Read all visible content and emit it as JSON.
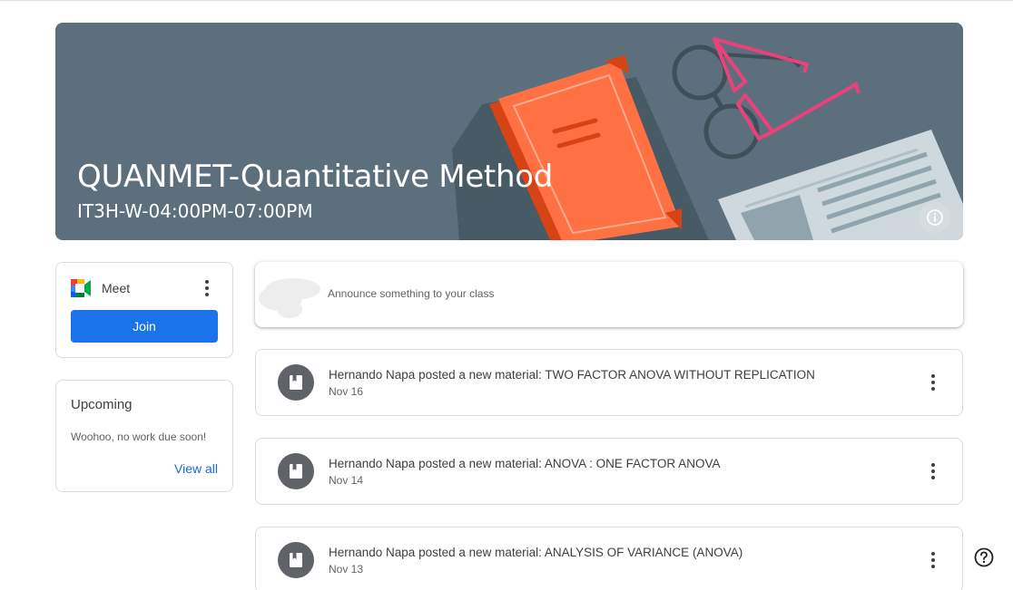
{
  "banner": {
    "title": "QUANMET-Quantitative Method",
    "subtitle": "IT3H-W-04:00PM-07:00PM",
    "bg_color": "#5b707c"
  },
  "meet": {
    "label": "Meet",
    "join_label": "Join",
    "icon": "google-meet-icon"
  },
  "upcoming": {
    "title": "Upcoming",
    "message": "Woohoo, no work due soon!",
    "view_all_label": "View all"
  },
  "announce": {
    "placeholder": "Announce something to your class"
  },
  "stream": {
    "posts": [
      {
        "title": "Hernando Napa posted a new material: TWO FACTOR ANOVA WITHOUT REPLICATION",
        "date": "Nov 16"
      },
      {
        "title": "Hernando Napa posted a new material: ANOVA : ONE FACTOR ANOVA",
        "date": "Nov 14"
      },
      {
        "title": "Hernando Napa posted a new material: ANALYSIS OF VARIANCE (ANOVA)",
        "date": "Nov 13"
      }
    ]
  },
  "colors": {
    "accent": "#1a73e8",
    "link": "#1967d2"
  }
}
